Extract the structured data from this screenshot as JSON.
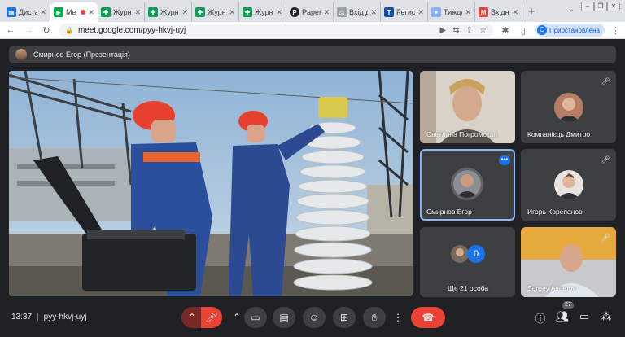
{
  "browser": {
    "tabs": [
      {
        "label": "Диста",
        "favicon_color": "#1a73e8",
        "favicon_glyph": "▦"
      },
      {
        "label": "Me",
        "favicon_color": "#00ac47",
        "favicon_glyph": "▶",
        "active": true
      },
      {
        "label": "Журн",
        "favicon_color": "#0f9d58",
        "favicon_glyph": "✚"
      },
      {
        "label": "Журн",
        "favicon_color": "#0f9d58",
        "favicon_glyph": "✚"
      },
      {
        "label": "Журн",
        "favicon_color": "#0f9d58",
        "favicon_glyph": "✚"
      },
      {
        "label": "Журн",
        "favicon_color": "#0f9d58",
        "favicon_glyph": "✚"
      },
      {
        "label": "Paperl",
        "favicon_color": "#202124",
        "favicon_glyph": "P"
      },
      {
        "label": "Вхід д",
        "favicon_color": "#5f6368",
        "favicon_glyph": "⚖"
      },
      {
        "label": "Регист",
        "favicon_color": "#174ea6",
        "favicon_glyph": "T"
      },
      {
        "label": "Тиждє",
        "favicon_color": "#8ab4f8",
        "favicon_glyph": "✦"
      },
      {
        "label": "Вхідні",
        "favicon_color": "#ea4335",
        "favicon_glyph": "M"
      }
    ],
    "new_tab": "+",
    "url": "meet.google.com/pyy-hkvj-uyj",
    "profile_label": "Приостановлена",
    "profile_initial": "C"
  },
  "meet": {
    "presenter_label": "Смирнов Егор (Презентація)",
    "participants": [
      {
        "name": "Светлана Погромская"
      },
      {
        "name": "Компанієць Дмитро"
      },
      {
        "name": "Смирнов Егор"
      },
      {
        "name": "Игорь Корепанов"
      },
      {
        "name": "Ще 21 особа",
        "count": "0"
      },
      {
        "name": "Sergey Astapov"
      }
    ],
    "time": "13:37",
    "meeting_code": "pyy-hkvj-uyj",
    "people_count": "27"
  },
  "colors": {
    "accent": "#1a73e8",
    "end_call": "#ea4335",
    "bg": "#202124",
    "tile": "#3c4043"
  }
}
